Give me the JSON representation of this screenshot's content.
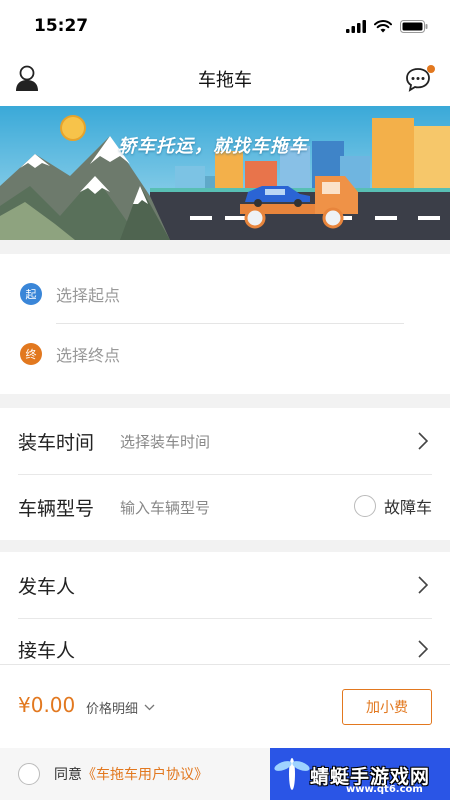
{
  "status": {
    "time": "15:27"
  },
  "nav": {
    "title": "车拖车"
  },
  "banner": {
    "slogan": "轿车托运，就找车拖车"
  },
  "route": {
    "start_badge": "起",
    "start_placeholder": "选择起点",
    "end_badge": "终",
    "end_placeholder": "选择终点"
  },
  "info": {
    "load_time_label": "装车时间",
    "load_time_value": "选择装车时间",
    "model_label": "车辆型号",
    "model_placeholder": "输入车辆型号",
    "breakdown_label": "故障车"
  },
  "people": {
    "sender_label": "发车人",
    "receiver_label": "接车人"
  },
  "footer": {
    "price": "¥0.00",
    "price_detail": "价格明细",
    "tip_button": "加小费",
    "agree_prefix": "同意",
    "agree_link": "《车拖车用户协议》"
  },
  "watermark": {
    "title": "蜻蜓手游戏网",
    "url": "www.qt6.com"
  },
  "colors": {
    "accent": "#e2781f",
    "start": "#3a86d8",
    "end": "#e2781f",
    "panel": "#2a55e6"
  }
}
